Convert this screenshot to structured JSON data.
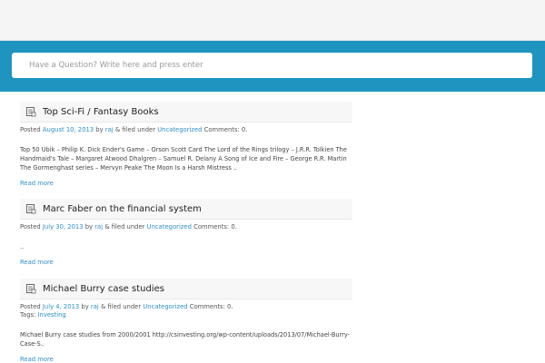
{
  "search": {
    "placeholder": "Have a Question? Write here and press enter"
  },
  "posts": [
    {
      "title": "Top Sci-Fi / Fantasy Books",
      "posted_label": "Posted",
      "date": "August 10, 2013",
      "by_label": "by",
      "author": "raj",
      "filed_label": "& filed under",
      "category": "Uncategorized",
      "comments": "Comments: 0.",
      "excerpt": "Top 50 Ubik – Philip K. Dick Ender's Game – Orson Scott Card The Lord of the Rings trilogy – J.R.R. Tolkien The Handmaid's Tale – Margaret Atwood Dhalgren – Samuel R. Delany A Song of Ice and Fire – George R.R. Martin The Gormenghast series – Mervyn Peake The Moon Is a Harsh Mistress ..",
      "read_more": "Read more"
    },
    {
      "title": "Marc Faber on the financial system",
      "posted_label": "Posted",
      "date": "July 30, 2013",
      "by_label": "by",
      "author": "raj",
      "filed_label": "& filed under",
      "category": "Uncategorized",
      "comments": "Comments: 0.",
      "excerpt": "..",
      "read_more": "Read more"
    },
    {
      "title": "Michael Burry case studies",
      "posted_label": "Posted",
      "date": "July 4, 2013",
      "by_label": "by",
      "author": "raj",
      "filed_label": "& filed under",
      "category": "Uncategorized",
      "comments": "Comments: 0.",
      "tags_label": "Tags:",
      "tag": "Investing",
      "excerpt": "Michael Burry case studies from 2000/2001 http://csinvesting.org/wp-content/uploads/2013/07/Michael-Burry-Case-S..",
      "read_more": "Read more"
    }
  ],
  "colors": {
    "accent": "#1f94c1",
    "link": "#2e8fc9"
  },
  "icons": {
    "post": "document-icon"
  }
}
